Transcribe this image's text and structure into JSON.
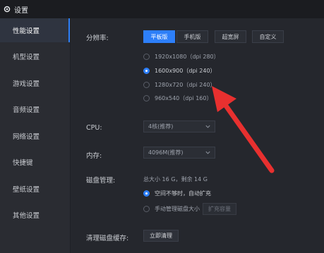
{
  "window": {
    "title": "设置"
  },
  "sidebar": {
    "items": [
      {
        "label": "性能设置",
        "active": true
      },
      {
        "label": "机型设置"
      },
      {
        "label": "游戏设置"
      },
      {
        "label": "音频设置"
      },
      {
        "label": "网络设置"
      },
      {
        "label": "快捷键"
      },
      {
        "label": "壁纸设置"
      },
      {
        "label": "其他设置"
      }
    ]
  },
  "resolution": {
    "label": "分辨率:",
    "modes": [
      "平板版",
      "手机版",
      "超宽屏",
      "自定义"
    ],
    "active_mode": "平板版",
    "options": [
      {
        "label": "1920x1080（dpi 280）",
        "checked": false
      },
      {
        "label": "1600x900（dpi 240）",
        "checked": true
      },
      {
        "label": "1280x720（dpi 240）",
        "checked": false
      },
      {
        "label": "960x540（dpi 160）",
        "checked": false
      }
    ]
  },
  "cpu": {
    "label": "CPU:",
    "value": "4核(推荐)"
  },
  "memory": {
    "label": "内存:",
    "value": "4096M(推荐)"
  },
  "disk": {
    "label": "磁盘管理:",
    "summary": "总大小 16 G，剩余 14 G",
    "options": [
      {
        "label": "空间不够时，自动扩充",
        "checked": true
      },
      {
        "label": "手动管理磁盘大小",
        "checked": false
      }
    ],
    "expand_button": "扩充容量"
  },
  "cache": {
    "label": "清理磁盘缓存:",
    "button": "立即清理"
  },
  "colors": {
    "accent": "#2d7ff9",
    "arrow": "#e8302f",
    "background": "#25272d"
  },
  "icons": {
    "title": "gear-icon",
    "select": "chevron-down-icon",
    "annotation": "red-arrow"
  }
}
